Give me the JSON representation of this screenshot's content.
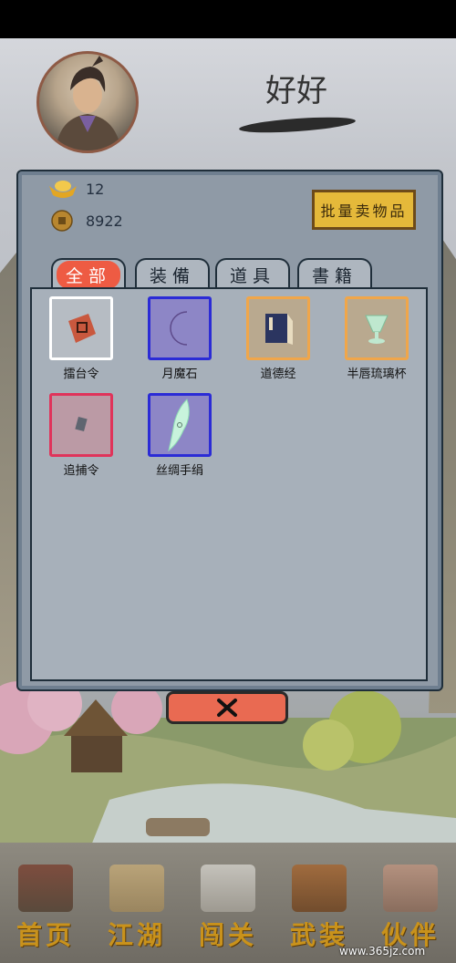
{
  "header": {
    "player_name": "好好"
  },
  "currency": {
    "ingot": "12",
    "coins": "8922"
  },
  "buttons": {
    "batch_sell": "批量卖物品"
  },
  "tabs": [
    {
      "label": "全部",
      "active": true
    },
    {
      "label": "装備",
      "active": false
    },
    {
      "label": "道具",
      "active": false
    },
    {
      "label": "書籍",
      "active": false
    }
  ],
  "items": [
    {
      "name": "擂台令",
      "rarity_color": "#ffffff",
      "icon": "token-icon"
    },
    {
      "name": "月魔石",
      "rarity_color": "#2b2bd6",
      "icon": "crescent-stone-icon"
    },
    {
      "name": "道德经",
      "rarity_color": "#f0a64a",
      "icon": "book-icon"
    },
    {
      "name": "半唇琉璃杯",
      "rarity_color": "#f0a64a",
      "icon": "glass-cup-icon"
    },
    {
      "name": "追捕令",
      "rarity_color": "#e0335a",
      "icon": "warrant-icon"
    },
    {
      "name": "丝绸手绢",
      "rarity_color": "#2b2bd6",
      "icon": "silk-handkerchief-icon"
    }
  ],
  "bottom_nav": [
    {
      "label": "首页",
      "icon": "house-icon"
    },
    {
      "label": "江湖",
      "icon": "scroll-icon"
    },
    {
      "label": "闯关",
      "icon": "crossed-swords-icon"
    },
    {
      "label": "武装",
      "icon": "armor-icon"
    },
    {
      "label": "伙伴",
      "icon": "companions-icon"
    }
  ],
  "watermark": "www.365jz.com",
  "colors": {
    "accent_red": "#ee5b43",
    "gold": "#e5b93a",
    "nav_gold": "#c9921b"
  }
}
